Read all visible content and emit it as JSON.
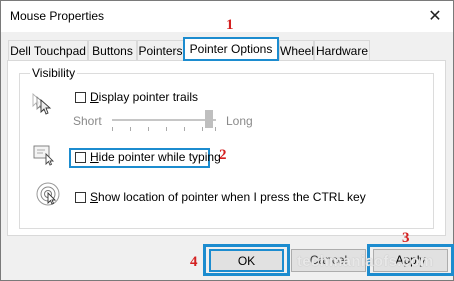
{
  "window": {
    "title": "Mouse Properties",
    "close_glyph": "✕"
  },
  "tabs": [
    {
      "label": "Dell Touchpad"
    },
    {
      "label": "Buttons"
    },
    {
      "label": "Pointers"
    },
    {
      "label": "Pointer Options",
      "selected": true
    },
    {
      "label": "Wheel"
    },
    {
      "label": "Hardware"
    }
  ],
  "visibility": {
    "group_label": "Visibility",
    "trails": {
      "label_hotkey": "D",
      "label_rest": "isplay pointer trails",
      "checked": false
    },
    "slider": {
      "min_label": "Short",
      "max_label": "Long",
      "value_fraction": 0.95,
      "enabled": false
    },
    "hide_typing": {
      "label_hotkey": "H",
      "label_rest": "ide pointer while typing",
      "checked": false
    },
    "show_location": {
      "label_hotkey": "S",
      "label_rest": "how location of pointer when I press the CTRL key",
      "checked": false
    }
  },
  "buttons": {
    "ok": "OK",
    "cancel": "Cancel",
    "apply": "Apply"
  },
  "annotations": {
    "n1": "1",
    "n2": "2",
    "n3": "3",
    "n4": "4"
  },
  "watermark": "techmaniaofs.com",
  "colors": {
    "highlight": "#1c8ccf",
    "annotation": "#d42020"
  }
}
